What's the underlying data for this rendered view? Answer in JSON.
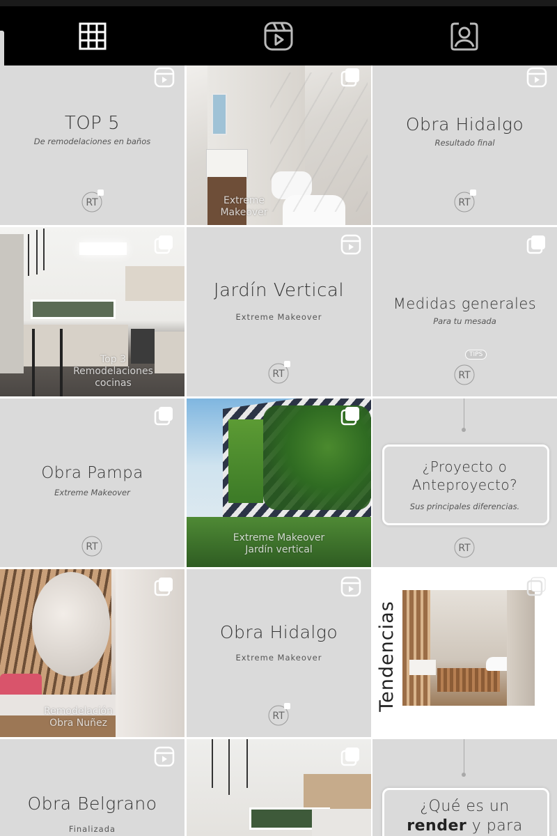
{
  "tabs": [
    {
      "name": "grid",
      "icon": "grid-icon"
    },
    {
      "name": "reels",
      "icon": "reels-icon"
    },
    {
      "name": "tagged",
      "icon": "tagged-person-icon"
    }
  ],
  "brand_logo": "RT",
  "posts": [
    {
      "title": "TOP 5",
      "subtitle": "De remodelaciones en baños",
      "icon": "reels-icon"
    },
    {
      "caption": "Extreme\nMakeover",
      "icon": "carousel-icon"
    },
    {
      "title": "Obra Hidalgo",
      "subtitle": "Resultado final",
      "icon": "reels-icon"
    },
    {
      "caption": "Top 3\nRemodelaciones\ncocinas",
      "icon": "carousel-icon"
    },
    {
      "title": "Jardín Vertical",
      "subtitle": "Extreme Makeover",
      "icon": "reels-icon"
    },
    {
      "title": "Medidas generales",
      "subtitle": "Para tu mesada",
      "badge": "TIPS",
      "icon": "carousel-icon"
    },
    {
      "title": "Obra Pampa",
      "subtitle": "Extreme Makeover",
      "icon": "carousel-icon"
    },
    {
      "caption": "Extreme Makeover\nJardín vertical",
      "icon": "carousel-icon"
    },
    {
      "title_line1": "¿Proyecto o",
      "title_line2": "Anteproyecto?",
      "subtitle": "Sus principales diferencias."
    },
    {
      "caption": "Remodelación\nObra Nuñez",
      "icon": "carousel-icon"
    },
    {
      "title": "Obra Hidalgo",
      "subtitle": "Extreme Makeover",
      "icon": "reels-icon"
    },
    {
      "vertical_title": "Tendencias",
      "icon": "carousel-icon"
    },
    {
      "title": "Obra Belgrano",
      "subtitle": "Finalizada",
      "icon": "reels-icon"
    },
    {
      "icon": "carousel-icon"
    },
    {
      "title_line1": "¿Qué es un",
      "title_line2_bold": "render",
      "title_line2_rest": " y para"
    }
  ]
}
